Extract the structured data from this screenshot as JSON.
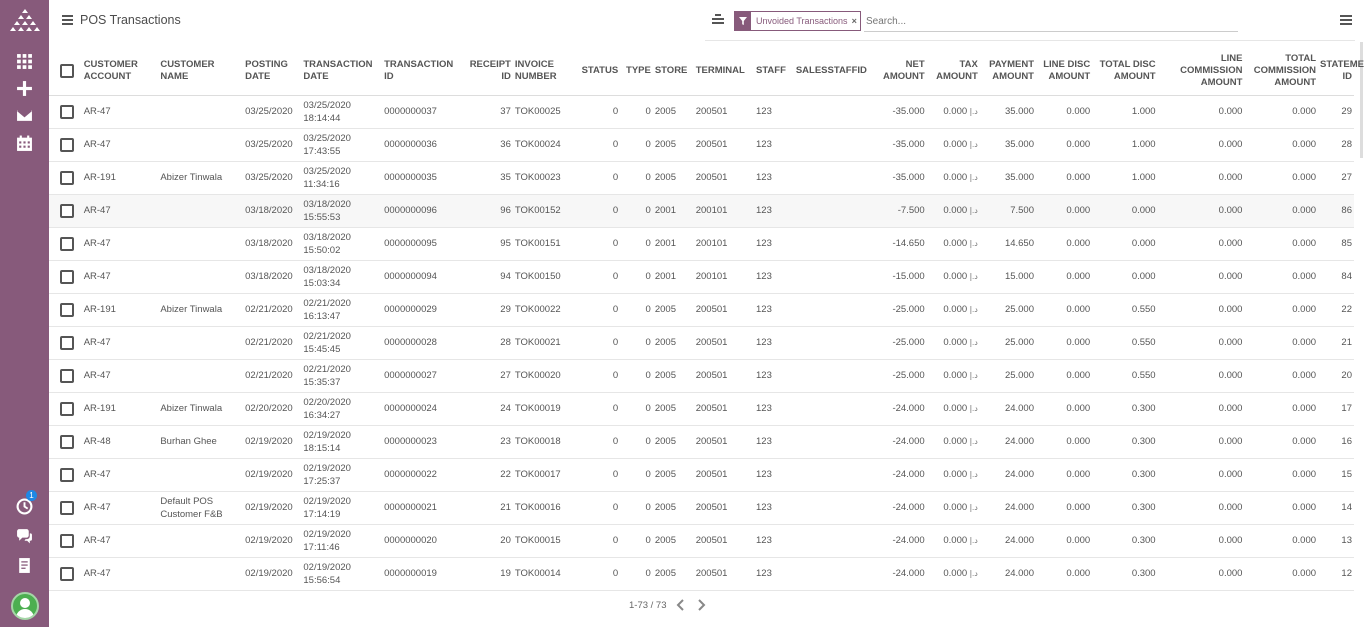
{
  "app": {
    "title": "POS Transactions"
  },
  "search": {
    "placeholder": "Search..."
  },
  "filter": {
    "facet_label": "Unvoided Transactions",
    "remove": "×"
  },
  "accent_color": "#875a7b",
  "sidebar": {
    "items": [
      {
        "icon": "apps-grid-icon"
      },
      {
        "icon": "plus-icon"
      },
      {
        "icon": "mail-icon"
      },
      {
        "icon": "calendar-icon"
      },
      {
        "icon": "activity-icon",
        "badge": "1"
      },
      {
        "icon": "chat-icon"
      },
      {
        "icon": "document-icon"
      }
    ]
  },
  "table": {
    "headers": [
      "CUSTOMER ACCOUNT",
      "CUSTOMER NAME",
      "POSTING DATE",
      "TRANSACTION DATE",
      "TRANSACTION ID",
      "RECEIPT ID",
      "INVOICE NUMBER",
      "STATUS",
      "TYPE",
      "STORE",
      "TERMINAL",
      "STAFF",
      "SALESSTAFFID",
      "NET AMOUNT",
      "TAX AMOUNT",
      "PAYMENT AMOUNT",
      "LINE DISC AMOUNT",
      "TOTAL DISC AMOUNT",
      "LINE COMMISSION AMOUNT",
      "TOTAL COMMISSION AMOUNT",
      "STATEMENT ID"
    ],
    "currency": "د.إ",
    "rows": [
      {
        "account": "AR-47",
        "name": "",
        "posting": "03/25/2020",
        "trans_date": "03/25/2020",
        "trans_time": "18:14:44",
        "trans_id": "0000000037",
        "receipt": "37",
        "invoice": "TOK00025",
        "status": "0",
        "type": "0",
        "store": "2005",
        "terminal": "200501",
        "staff": "123",
        "salesstaff": "",
        "net": "-35.000",
        "tax": "0.000",
        "payment": "35.000",
        "line_disc": "0.000",
        "total_disc": "1.000",
        "line_comm": "0.000",
        "total_comm": "0.000",
        "statement": "29"
      },
      {
        "account": "AR-47",
        "name": "",
        "posting": "03/25/2020",
        "trans_date": "03/25/2020",
        "trans_time": "17:43:55",
        "trans_id": "0000000036",
        "receipt": "36",
        "invoice": "TOK00024",
        "status": "0",
        "type": "0",
        "store": "2005",
        "terminal": "200501",
        "staff": "123",
        "salesstaff": "",
        "net": "-35.000",
        "tax": "0.000",
        "payment": "35.000",
        "line_disc": "0.000",
        "total_disc": "1.000",
        "line_comm": "0.000",
        "total_comm": "0.000",
        "statement": "28"
      },
      {
        "account": "AR-191",
        "name": "Abizer Tinwala",
        "posting": "03/25/2020",
        "trans_date": "03/25/2020",
        "trans_time": "11:34:16",
        "trans_id": "0000000035",
        "receipt": "35",
        "invoice": "TOK00023",
        "status": "0",
        "type": "0",
        "store": "2005",
        "terminal": "200501",
        "staff": "123",
        "salesstaff": "",
        "net": "-35.000",
        "tax": "0.000",
        "payment": "35.000",
        "line_disc": "0.000",
        "total_disc": "1.000",
        "line_comm": "0.000",
        "total_comm": "0.000",
        "statement": "27"
      },
      {
        "account": "AR-47",
        "name": "",
        "posting": "03/18/2020",
        "trans_date": "03/18/2020",
        "trans_time": "15:55:53",
        "trans_id": "0000000096",
        "receipt": "96",
        "invoice": "TOK00152",
        "status": "0",
        "type": "0",
        "store": "2001",
        "terminal": "200101",
        "staff": "123",
        "salesstaff": "",
        "net": "-7.500",
        "tax": "0.000",
        "payment": "7.500",
        "line_disc": "0.000",
        "total_disc": "0.000",
        "line_comm": "0.000",
        "total_comm": "0.000",
        "statement": "86"
      },
      {
        "account": "AR-47",
        "name": "",
        "posting": "03/18/2020",
        "trans_date": "03/18/2020",
        "trans_time": "15:50:02",
        "trans_id": "0000000095",
        "receipt": "95",
        "invoice": "TOK00151",
        "status": "0",
        "type": "0",
        "store": "2001",
        "terminal": "200101",
        "staff": "123",
        "salesstaff": "",
        "net": "-14.650",
        "tax": "0.000",
        "payment": "14.650",
        "line_disc": "0.000",
        "total_disc": "0.000",
        "line_comm": "0.000",
        "total_comm": "0.000",
        "statement": "85"
      },
      {
        "account": "AR-47",
        "name": "",
        "posting": "03/18/2020",
        "trans_date": "03/18/2020",
        "trans_time": "15:03:34",
        "trans_id": "0000000094",
        "receipt": "94",
        "invoice": "TOK00150",
        "status": "0",
        "type": "0",
        "store": "2001",
        "terminal": "200101",
        "staff": "123",
        "salesstaff": "",
        "net": "-15.000",
        "tax": "0.000",
        "payment": "15.000",
        "line_disc": "0.000",
        "total_disc": "0.000",
        "line_comm": "0.000",
        "total_comm": "0.000",
        "statement": "84"
      },
      {
        "account": "AR-191",
        "name": "Abizer Tinwala",
        "posting": "02/21/2020",
        "trans_date": "02/21/2020",
        "trans_time": "16:13:47",
        "trans_id": "0000000029",
        "receipt": "29",
        "invoice": "TOK00022",
        "status": "0",
        "type": "0",
        "store": "2005",
        "terminal": "200501",
        "staff": "123",
        "salesstaff": "",
        "net": "-25.000",
        "tax": "0.000",
        "payment": "25.000",
        "line_disc": "0.000",
        "total_disc": "0.550",
        "line_comm": "0.000",
        "total_comm": "0.000",
        "statement": "22"
      },
      {
        "account": "AR-47",
        "name": "",
        "posting": "02/21/2020",
        "trans_date": "02/21/2020",
        "trans_time": "15:45:45",
        "trans_id": "0000000028",
        "receipt": "28",
        "invoice": "TOK00021",
        "status": "0",
        "type": "0",
        "store": "2005",
        "terminal": "200501",
        "staff": "123",
        "salesstaff": "",
        "net": "-25.000",
        "tax": "0.000",
        "payment": "25.000",
        "line_disc": "0.000",
        "total_disc": "0.550",
        "line_comm": "0.000",
        "total_comm": "0.000",
        "statement": "21"
      },
      {
        "account": "AR-47",
        "name": "",
        "posting": "02/21/2020",
        "trans_date": "02/21/2020",
        "trans_time": "15:35:37",
        "trans_id": "0000000027",
        "receipt": "27",
        "invoice": "TOK00020",
        "status": "0",
        "type": "0",
        "store": "2005",
        "terminal": "200501",
        "staff": "123",
        "salesstaff": "",
        "net": "-25.000",
        "tax": "0.000",
        "payment": "25.000",
        "line_disc": "0.000",
        "total_disc": "0.550",
        "line_comm": "0.000",
        "total_comm": "0.000",
        "statement": "20"
      },
      {
        "account": "AR-191",
        "name": "Abizer Tinwala",
        "posting": "02/20/2020",
        "trans_date": "02/20/2020",
        "trans_time": "16:34:27",
        "trans_id": "0000000024",
        "receipt": "24",
        "invoice": "TOK00019",
        "status": "0",
        "type": "0",
        "store": "2005",
        "terminal": "200501",
        "staff": "123",
        "salesstaff": "",
        "net": "-24.000",
        "tax": "0.000",
        "payment": "24.000",
        "line_disc": "0.000",
        "total_disc": "0.300",
        "line_comm": "0.000",
        "total_comm": "0.000",
        "statement": "17"
      },
      {
        "account": "AR-48",
        "name": "Burhan Ghee",
        "posting": "02/19/2020",
        "trans_date": "02/19/2020",
        "trans_time": "18:15:14",
        "trans_id": "0000000023",
        "receipt": "23",
        "invoice": "TOK00018",
        "status": "0",
        "type": "0",
        "store": "2005",
        "terminal": "200501",
        "staff": "123",
        "salesstaff": "",
        "net": "-24.000",
        "tax": "0.000",
        "payment": "24.000",
        "line_disc": "0.000",
        "total_disc": "0.300",
        "line_comm": "0.000",
        "total_comm": "0.000",
        "statement": "16"
      },
      {
        "account": "AR-47",
        "name": "",
        "posting": "02/19/2020",
        "trans_date": "02/19/2020",
        "trans_time": "17:25:37",
        "trans_id": "0000000022",
        "receipt": "22",
        "invoice": "TOK00017",
        "status": "0",
        "type": "0",
        "store": "2005",
        "terminal": "200501",
        "staff": "123",
        "salesstaff": "",
        "net": "-24.000",
        "tax": "0.000",
        "payment": "24.000",
        "line_disc": "0.000",
        "total_disc": "0.300",
        "line_comm": "0.000",
        "total_comm": "0.000",
        "statement": "15"
      },
      {
        "account": "AR-47",
        "name": "Default POS Customer F&B",
        "posting": "02/19/2020",
        "trans_date": "02/19/2020",
        "trans_time": "17:14:19",
        "trans_id": "0000000021",
        "receipt": "21",
        "invoice": "TOK00016",
        "status": "0",
        "type": "0",
        "store": "2005",
        "terminal": "200501",
        "staff": "123",
        "salesstaff": "",
        "net": "-24.000",
        "tax": "0.000",
        "payment": "24.000",
        "line_disc": "0.000",
        "total_disc": "0.300",
        "line_comm": "0.000",
        "total_comm": "0.000",
        "statement": "14"
      },
      {
        "account": "AR-47",
        "name": "",
        "posting": "02/19/2020",
        "trans_date": "02/19/2020",
        "trans_time": "17:11:46",
        "trans_id": "0000000020",
        "receipt": "20",
        "invoice": "TOK00015",
        "status": "0",
        "type": "0",
        "store": "2005",
        "terminal": "200501",
        "staff": "123",
        "salesstaff": "",
        "net": "-24.000",
        "tax": "0.000",
        "payment": "24.000",
        "line_disc": "0.000",
        "total_disc": "0.300",
        "line_comm": "0.000",
        "total_comm": "0.000",
        "statement": "13"
      },
      {
        "account": "AR-47",
        "name": "",
        "posting": "02/19/2020",
        "trans_date": "02/19/2020",
        "trans_time": "15:56:54",
        "trans_id": "0000000019",
        "receipt": "19",
        "invoice": "TOK00014",
        "status": "0",
        "type": "0",
        "store": "2005",
        "terminal": "200501",
        "staff": "123",
        "salesstaff": "",
        "net": "-24.000",
        "tax": "0.000",
        "payment": "24.000",
        "line_disc": "0.000",
        "total_disc": "0.300",
        "line_comm": "0.000",
        "total_comm": "0.000",
        "statement": "12"
      }
    ]
  },
  "pager": {
    "label": "1-73 / 73"
  }
}
